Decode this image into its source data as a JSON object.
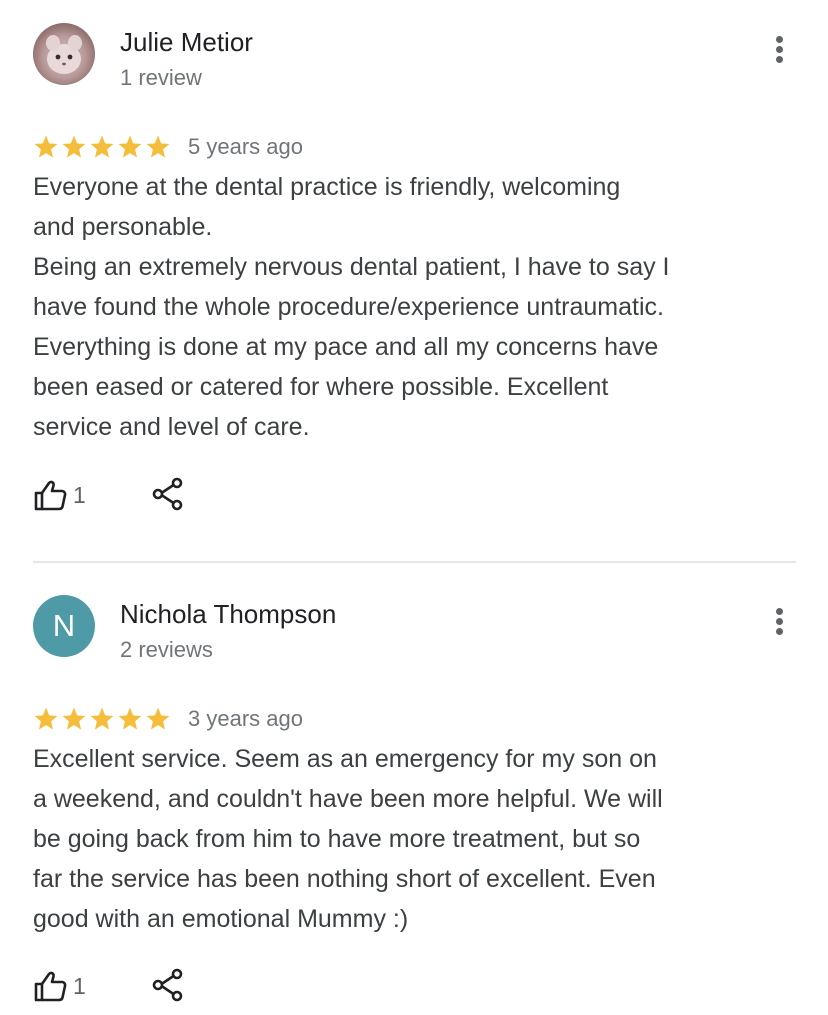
{
  "colors": {
    "star": "#f4be3c",
    "avatar_letter_bg": "#4e9aa6",
    "secondary_text": "#70757a",
    "body_text": "#3c4043"
  },
  "reviews": [
    {
      "author": "Julie Metior",
      "avatar_type": "photo",
      "review_count": "1 review",
      "rating": 5,
      "rating_max": 5,
      "time": "5 years ago",
      "text_lines": [
        "Everyone at the dental practice is friendly, welcoming",
        "and personable.",
        "Being an extremely nervous dental patient, I have to say I",
        "have found the whole procedure/experience untraumatic.",
        "Everything is done at my pace and all my concerns have",
        "been eased or catered for where possible. Excellent",
        "service and level of care."
      ],
      "likes": "1",
      "icons": [
        "more-vert-icon",
        "thumb-up-icon",
        "share-icon",
        "star-icon"
      ]
    },
    {
      "author": "Nichola Thompson",
      "avatar_type": "letter",
      "avatar_letter": "N",
      "review_count": "2 reviews",
      "rating": 5,
      "rating_max": 5,
      "time": "3 years ago",
      "text_lines": [
        "Excellent service. Seem as an emergency for my son on",
        "a weekend, and couldn't have been more helpful. We will",
        "be going back from him to have more treatment, but so",
        "far the service has been nothing short of excellent. Even",
        "good with an emotional Mummy :)"
      ],
      "likes": "1",
      "icons": [
        "more-vert-icon",
        "thumb-up-icon",
        "share-icon",
        "star-icon"
      ]
    }
  ]
}
